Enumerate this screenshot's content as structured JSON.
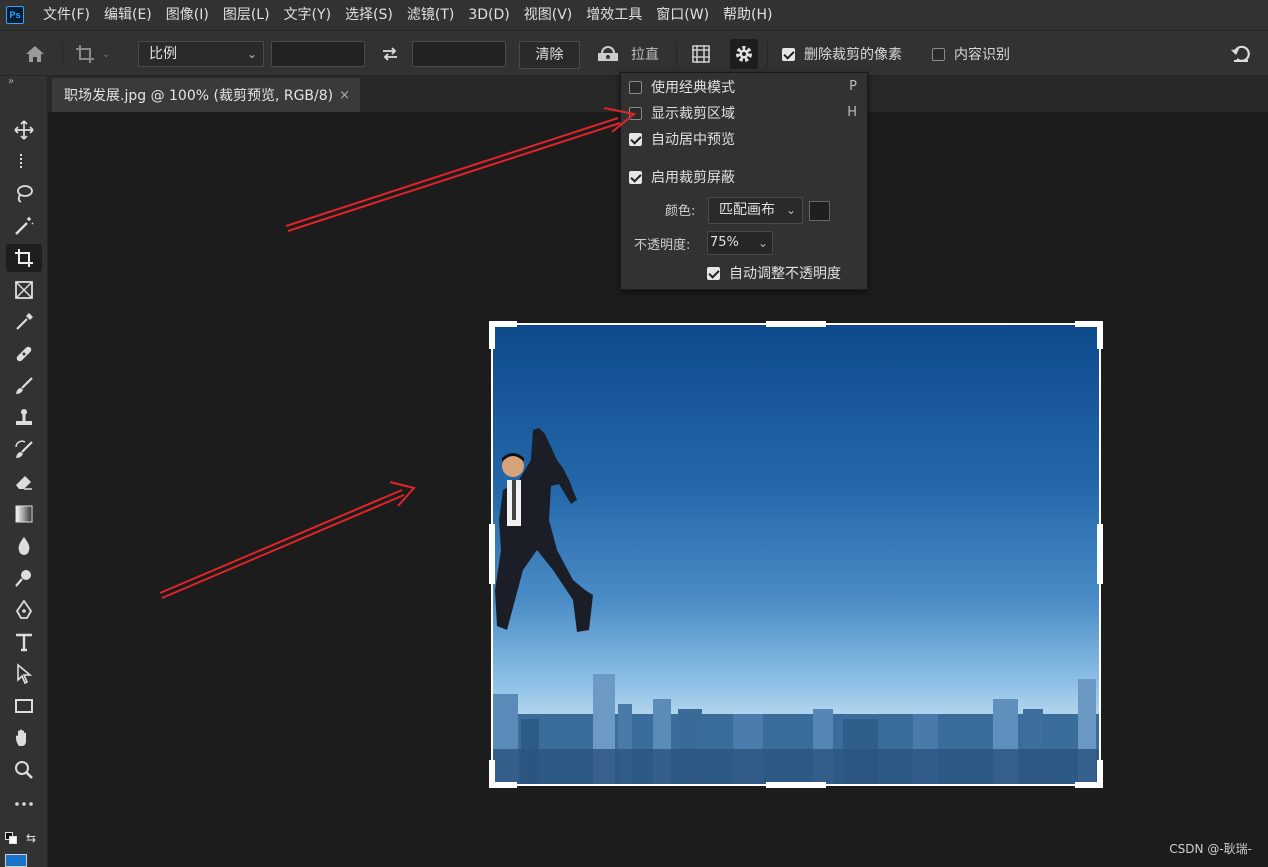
{
  "menubar": {
    "logo": "Ps",
    "items": [
      "文件(F)",
      "编辑(E)",
      "图像(I)",
      "图层(L)",
      "文字(Y)",
      "选择(S)",
      "滤镜(T)",
      "3D(D)",
      "视图(V)",
      "增效工具",
      "窗口(W)",
      "帮助(H)"
    ]
  },
  "options": {
    "ratio_select": "比例",
    "width_value": "",
    "height_value": "",
    "clear_label": "清除",
    "straighten_label": "拉直",
    "delete_cropped_label": "删除裁剪的像素",
    "delete_cropped_checked": true,
    "content_aware_label": "内容识别",
    "content_aware_checked": false
  },
  "document": {
    "tab_title": "职场发展.jpg @ 100% (裁剪预览, RGB/8)",
    "close_glyph": "×"
  },
  "crop_settings": {
    "classic_mode_label": "使用经典模式",
    "classic_mode_shortcut": "P",
    "classic_mode_checked": false,
    "show_cropped_label": "显示裁剪区域",
    "show_cropped_shortcut": "H",
    "show_cropped_checked": false,
    "auto_center_label": "自动居中预览",
    "auto_center_checked": true,
    "enable_shield_label": "启用裁剪屏蔽",
    "enable_shield_checked": true,
    "color_label": "颜色:",
    "color_value": "匹配画布",
    "opacity_label": "不透明度:",
    "opacity_value": "75%",
    "auto_opacity_label": "自动调整不透明度",
    "auto_opacity_checked": true
  },
  "colors": {
    "annotation_arrow": "#e0242a",
    "foreground_color": "#1a73c7"
  },
  "watermark": "CSDN @-耿瑞-"
}
